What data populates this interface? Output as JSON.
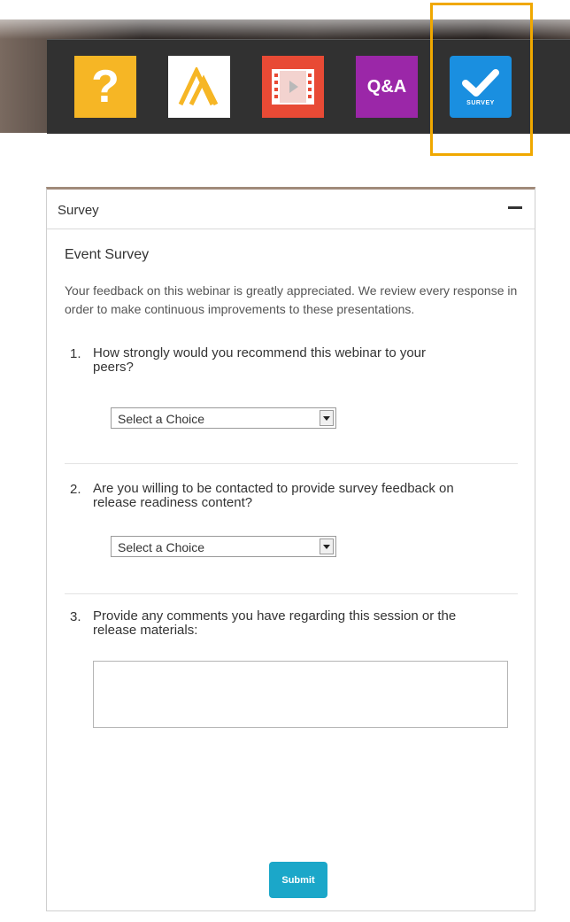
{
  "toolbar": {
    "icons": [
      {
        "name": "help-icon",
        "glyph": "?",
        "color": "#f6b625"
      },
      {
        "name": "logo-icon",
        "color": "#ffffff",
        "accent": "#f6b625"
      },
      {
        "name": "video-icon",
        "color": "#e84a35"
      },
      {
        "name": "qa-icon",
        "label": "Q&A",
        "color": "#9b27a8"
      },
      {
        "name": "survey-icon",
        "label": "SURVEY",
        "color": "#1a8fe0"
      }
    ],
    "highlight_color": "#f0a800"
  },
  "panel": {
    "title": "Survey",
    "event_title": "Event Survey",
    "intro": "Your feedback on this webinar is greatly appreciated. We review every response in order to make continuous improvements to these presentations.",
    "questions": [
      {
        "number": "1.",
        "text": "How strongly would you recommend this webinar to your peers?",
        "select_value": "Select a Choice"
      },
      {
        "number": "2.",
        "text": "Are you willing to be contacted to provide survey feedback on release readiness content?",
        "select_value": "Select a Choice"
      },
      {
        "number": "3.",
        "text": "Provide any comments you have regarding this session or the release materials:",
        "comment_value": ""
      }
    ],
    "submit_label": "Submit",
    "accent_color": "#1ba7c9"
  }
}
